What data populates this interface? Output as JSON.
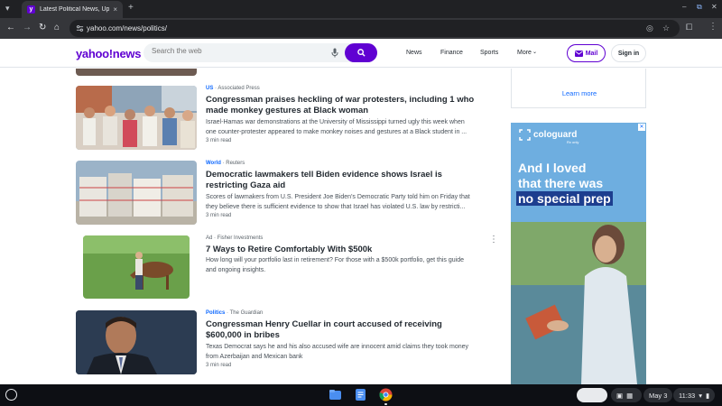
{
  "browser": {
    "tab_title": "Latest Political News, Update",
    "tab_close": "×",
    "new_tab": "+",
    "url": "yahoo.com/news/politics/"
  },
  "header": {
    "logo": "yahoo!news",
    "search_placeholder": "Search the web",
    "nav": [
      "News",
      "Finance",
      "Sports",
      "More"
    ],
    "more_caret": "⌄",
    "mail_label": "Mail",
    "signin_label": "Sign in",
    "accent_color": "#6001d2"
  },
  "articles": [
    {
      "category": "US",
      "source": "Associated Press",
      "headline": "Congressman praises heckling of war protesters, including 1 who made monkey gestures at Black woman",
      "summary": "Israel-Hamas war demonstrations at the University of Mississippi turned ugly this week when one counter-protester appeared to make monkey noises and gestures at a Black student in ...",
      "read_time": "3 min read"
    },
    {
      "category": "World",
      "source": "Reuters",
      "headline": "Democratic lawmakers tell Biden evidence shows Israel is restricting Gaza aid",
      "summary": "Scores of lawmakers from U.S. President Joe Biden's Democratic Party told him on Friday that they believe there is sufficient evidence to show that Israel has violated U.S. law by restricti...",
      "read_time": "3 min read"
    },
    {
      "category": "Ad",
      "source": "Fisher Investments",
      "headline": "7 Ways to Retire Comfortably With $500k",
      "summary": "How long will your portfolio last in retirement? For those with a $500k portfolio, get this guide and ongoing insights.",
      "read_time": ""
    },
    {
      "category": "Politics",
      "source": "The Guardian",
      "headline": "Congressman Henry Cuellar in court accused of receiving $600,000 in bribes",
      "summary": "Texas Democrat says he and his also accused wife are innocent amid claims they took money from Azerbaijan and Mexican bank",
      "read_time": "3 min read"
    }
  ],
  "sidebar": {
    "learn_more": "Learn more"
  },
  "ad": {
    "brand": "cologuard",
    "brand_sub": "Rx only",
    "line1": "And I loved",
    "line2": "that there was",
    "line3": "no special prep"
  },
  "shelf": {
    "date": "May 3",
    "time": "11:33"
  }
}
